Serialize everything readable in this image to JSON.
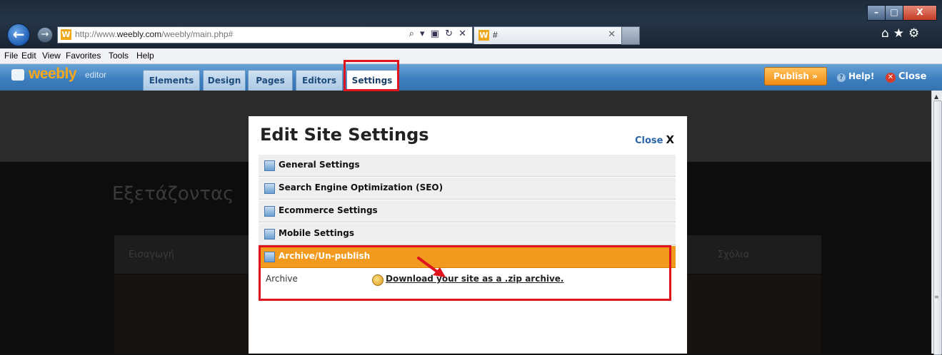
{
  "browser": {
    "url_prefix": "http://www.",
    "url_domain": "weebly.com",
    "url_path": "/weebly/main.php#",
    "favicon": "W",
    "address_tools": "⌕ ▾ ▣ ↻ ✕",
    "tab_title": "#",
    "tab_close": "✕",
    "back_icon": "←",
    "forward_icon": "→",
    "right_icons": "⌂★⚙",
    "win_min": "–",
    "win_max": "□",
    "win_close": "X"
  },
  "menubar": [
    "File",
    "Edit",
    "View",
    "Favorites",
    "Tools",
    "Help"
  ],
  "weebly": {
    "logo": "weebly",
    "logo_sub": "editor",
    "tabs": [
      "Elements",
      "Design",
      "Pages",
      "Editors",
      "Settings"
    ],
    "active_tab": "Settings",
    "publish": "Publish »",
    "help": "Help!",
    "close": "Close"
  },
  "page": {
    "title": "Εξετάζοντας",
    "nav_left": "Εισαγωγή",
    "nav_right": "Σχόλια"
  },
  "modal": {
    "title": "Edit Site Settings",
    "close": "Close",
    "close_x": "X",
    "sections": [
      "General Settings",
      "Search Engine Optimization (SEO)",
      "Ecommerce Settings",
      "Mobile Settings",
      "Archive/Un-publish"
    ],
    "active_section": "Archive/Un-publish",
    "archive_label": "Archive",
    "download_link": "Download your site as a .zip archive."
  },
  "annotation_color": "#e0141c",
  "accent_orange": "#f29a1e"
}
